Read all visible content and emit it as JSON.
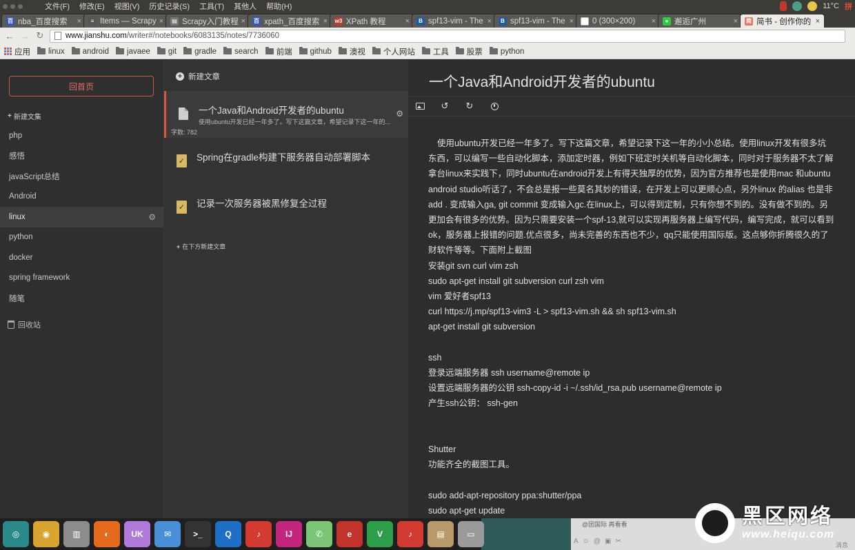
{
  "os": {
    "menu": [
      "文件(F)",
      "修改(E)",
      "视图(V)",
      "历史记录(S)",
      "工具(T)",
      "其他人",
      "帮助(H)"
    ],
    "weather": "11°C"
  },
  "tabs": [
    {
      "title": "nba_百度搜索",
      "favicon_color": "#3355cc",
      "favicon_glyph": "百",
      "active": false
    },
    {
      "title": "Items — Scrapy",
      "favicon_color": "#555555",
      "favicon_glyph": "≡",
      "active": false
    },
    {
      "title": "Scrapy入门教程",
      "favicon_color": "#777777",
      "favicon_glyph": "▤",
      "active": false
    },
    {
      "title": "xpath_百度搜索",
      "favicon_color": "#3355cc",
      "favicon_glyph": "百",
      "active": false
    },
    {
      "title": "XPath 教程",
      "favicon_color": "#c0392b",
      "favicon_glyph": "w3",
      "active": false
    },
    {
      "title": "spf13-vim - The",
      "favicon_color": "#1e5aa8",
      "favicon_glyph": "B",
      "active": false
    },
    {
      "title": "spf13-vim - The",
      "favicon_color": "#1e5aa8",
      "favicon_glyph": "B",
      "active": false
    },
    {
      "title": "0 (300×200)",
      "favicon_color": "#ffffff",
      "favicon_glyph": "",
      "active": false
    },
    {
      "title": "邂逅广州",
      "favicon_color": "#2ecc40",
      "favicon_glyph": "●",
      "active": false
    },
    {
      "title": "简书 - 创作你的",
      "favicon_color": "#e9735d",
      "favicon_glyph": "简",
      "active": true
    }
  ],
  "address": {
    "host": "www.jianshu.com",
    "path": "/writer#/notebooks/6083135/notes/7736060"
  },
  "bookmarks": [
    "应用",
    "linux",
    "android",
    "javaee",
    "git",
    "gradle",
    "search",
    "前端",
    "github",
    "澳视",
    "个人网站",
    "工具",
    "股票",
    "python"
  ],
  "sidebar": {
    "home_label": "回首页",
    "new_notebook_label": "新建文集",
    "notebooks": [
      "php",
      "感悟",
      "javaScript总结",
      "Android",
      "linux",
      "python",
      "docker",
      "spring framework",
      "随笔"
    ],
    "active_index": 4,
    "trash_label": "回收站"
  },
  "notes": {
    "new_note_label": "新建文章",
    "items": [
      {
        "title": "一个Java和Android开发者的ubuntu",
        "excerpt": "使用ubuntu开发已经一年多了。写下这篇文章，希望记录下这一年的...",
        "word_count": "字数: 782",
        "icon": "document-icon",
        "active": true
      },
      {
        "title": "Spring在gradle构建下服务器自动部署脚本",
        "icon": "published-icon",
        "active": false
      },
      {
        "title": "记录一次服务器被黑修复全过程",
        "icon": "published-icon",
        "active": false
      }
    ],
    "add_below_label": "在下方新建文章"
  },
  "editor": {
    "title": "一个Java和Android开发者的ubuntu",
    "lines": [
      "使用ubuntu开发已经一年多了。写下这篇文章，希望记录下这一年的小小总结。使用linux开发有很多坑",
      "东西，可以编写一些自动化脚本，添加定时器，例如下班定时关机等自动化脚本，同时对于服务器不太了解",
      "拿台linux来实践下，同时ubuntu在android开发上有得天独厚的优势，因为官方推荐也是使用mac 和ubuntu",
      "android studio听话了，不会总是报一些莫名其妙的错误，在开发上可以更顺心点，另外linux 的alias 也是非",
      "add . 变成输入ga, git commit 变成输入gc.在linux上，可以得到定制，只有你想不到的。没有做不到的。另",
      "更加会有很多的优势。因为只需要安装一个spf-13,就可以实现再服务器上编写代码，编写完成，就可以看到",
      "ok，服务器上报错的问题.优点很多，尚未完善的东西也不少，qq只能使用国际版。这点够你折腾很久的了",
      "财软件等等。下面附上截图",
      "安装git svn curl vim zsh",
      " sudo apt-get install git subversion curl zsh vim",
      "vim 爱好者spf13",
      "curl https://j.mp/spf13-vim3 -L > spf13-vim.sh && sh spf13-vim.sh",
      "apt-get install  git subversion",
      "",
      "ssh",
      "登录远端服务器 ssh username@remote ip",
      "设置远端服务器的公钥 ssh-copy-id -i ~/.ssh/id_rsa.pub username@remote ip",
      "产生ssh公钥： ssh-gen",
      "",
      "",
      "Shutter",
      "功能齐全的截图工具。",
      "",
      "sudo add-apt-repository ppa:shutter/ppa",
      "sudo apt-get update"
    ]
  },
  "dock": {
    "apps": [
      {
        "name": "ubuntu-software-icon",
        "color": "#2a8a8a",
        "glyph": "◎"
      },
      {
        "name": "chrome-icon",
        "color": "#d8a531",
        "glyph": "◉"
      },
      {
        "name": "file-cabinet-icon",
        "color": "#8c8c8c",
        "glyph": "▥"
      },
      {
        "name": "firefox-icon",
        "color": "#e56a1b",
        "glyph": "◐"
      },
      {
        "name": "shopping-bag-icon",
        "color": "#b07adb",
        "glyph": "UK"
      },
      {
        "name": "mail-icon",
        "color": "#4a90d9",
        "glyph": "✉"
      },
      {
        "name": "terminal-icon",
        "color": "#333333",
        "glyph": ">_"
      },
      {
        "name": "qq-icon",
        "color": "#1f6fc7",
        "glyph": "Q"
      },
      {
        "name": "netease-music-icon",
        "color": "#d33b32",
        "glyph": "♪"
      },
      {
        "name": "intellij-icon",
        "color": "#c4257d",
        "glyph": "IJ"
      },
      {
        "name": "wechat-icon",
        "color": "#7cc576",
        "glyph": "✆"
      },
      {
        "name": "document-viewer-icon",
        "color": "#c2332b",
        "glyph": "e"
      },
      {
        "name": "vim-icon",
        "color": "#2f9e4a",
        "glyph": "V"
      },
      {
        "name": "music-icon-2",
        "color": "#d33b32",
        "glyph": "♪"
      },
      {
        "name": "archive-icon",
        "color": "#b89a6a",
        "glyph": "▤"
      },
      {
        "name": "drive-icon",
        "color": "#9a9a9a",
        "glyph": "▭"
      }
    ],
    "chat_label": "@团国际 再看看",
    "chat_send": "消息"
  },
  "watermark": {
    "title": "黑区网络",
    "url": "www.heiqu.com"
  }
}
